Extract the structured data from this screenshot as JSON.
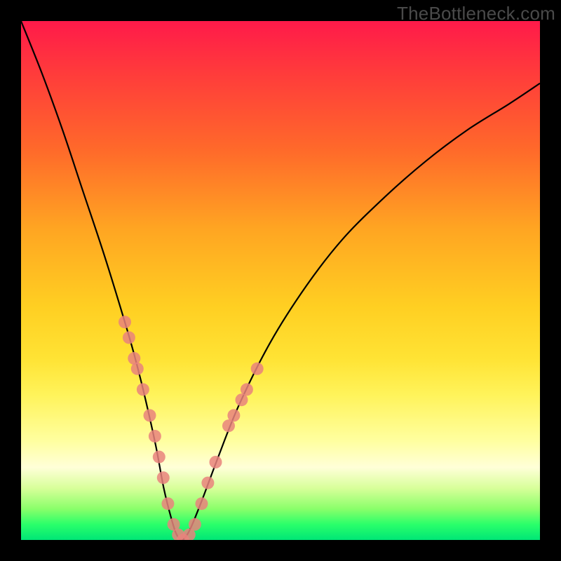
{
  "watermark": "TheBottleneck.com",
  "chart_data": {
    "type": "line",
    "title": "",
    "xlabel": "",
    "ylabel": "",
    "xlim": [
      0,
      100
    ],
    "ylim": [
      0,
      100
    ],
    "grid": false,
    "legend": false,
    "series": [
      {
        "name": "bottleneck-curve",
        "color": "#000000",
        "x": [
          0,
          4,
          8,
          12,
          16,
          20,
          22,
          24,
          26,
          27.5,
          29,
          30,
          31,
          32,
          33,
          35,
          38,
          42,
          48,
          55,
          62,
          70,
          78,
          86,
          94,
          100
        ],
        "y": [
          100,
          90,
          79,
          67,
          55,
          42,
          35,
          27,
          18,
          10,
          4,
          1,
          0,
          1,
          3,
          8,
          16,
          26,
          38,
          49,
          58,
          66,
          73,
          79,
          84,
          88
        ]
      }
    ],
    "markers": [
      {
        "name": "left-cluster",
        "color": "#e9837d",
        "radius_px": 9,
        "points": [
          {
            "x": 20.0,
            "y": 42
          },
          {
            "x": 20.8,
            "y": 39
          },
          {
            "x": 21.8,
            "y": 35
          },
          {
            "x": 22.4,
            "y": 33
          },
          {
            "x": 23.5,
            "y": 29
          },
          {
            "x": 24.8,
            "y": 24
          },
          {
            "x": 25.8,
            "y": 20
          },
          {
            "x": 26.6,
            "y": 16
          },
          {
            "x": 27.4,
            "y": 12
          },
          {
            "x": 28.3,
            "y": 7
          },
          {
            "x": 29.4,
            "y": 3
          },
          {
            "x": 30.3,
            "y": 1
          },
          {
            "x": 31.2,
            "y": 0
          },
          {
            "x": 32.4,
            "y": 1
          },
          {
            "x": 33.5,
            "y": 3
          },
          {
            "x": 34.8,
            "y": 7
          },
          {
            "x": 36.0,
            "y": 11
          },
          {
            "x": 37.5,
            "y": 15
          },
          {
            "x": 40.0,
            "y": 22
          },
          {
            "x": 41.0,
            "y": 24
          },
          {
            "x": 42.5,
            "y": 27
          },
          {
            "x": 43.5,
            "y": 29
          },
          {
            "x": 45.5,
            "y": 33
          }
        ]
      }
    ]
  }
}
